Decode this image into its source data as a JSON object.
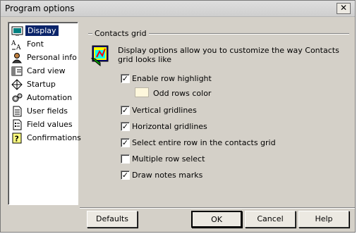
{
  "window": {
    "title": "Program options",
    "close_glyph": "✕"
  },
  "nav": {
    "items": [
      {
        "label": "Display",
        "icon": "display-icon",
        "selected": true
      },
      {
        "label": "Font",
        "icon": "font-icon"
      },
      {
        "label": "Personal info",
        "icon": "person-icon"
      },
      {
        "label": "Card view",
        "icon": "card-icon"
      },
      {
        "label": "Startup",
        "icon": "startup-icon"
      },
      {
        "label": "Automation",
        "icon": "gear-icon"
      },
      {
        "label": "User fields",
        "icon": "document-icon"
      },
      {
        "label": "Field values",
        "icon": "list-icon"
      },
      {
        "label": "Confirmations",
        "icon": "question-icon"
      }
    ]
  },
  "panel": {
    "group_title": "Contacts grid",
    "description": "Display options allow you to customize the way Contacts grid looks like",
    "options": [
      {
        "label": "Enable row highlight",
        "checked": true
      },
      {
        "label": "Vertical gridlines",
        "checked": true
      },
      {
        "label": "Horizontal gridlines",
        "checked": true
      },
      {
        "label": "Select entire row in the contacts grid",
        "checked": true
      },
      {
        "label": "Multiple row select",
        "checked": false
      },
      {
        "label": "Draw notes marks",
        "checked": true
      }
    ],
    "odd_rows_color_label": "Odd rows color",
    "odd_rows_color": "#fdf7dc"
  },
  "buttons": {
    "defaults": "Defaults",
    "ok": "OK",
    "cancel": "Cancel",
    "help": "Help"
  },
  "colors": {
    "selection": "#0a246a",
    "dialog_bg": "#d4d0c8"
  }
}
